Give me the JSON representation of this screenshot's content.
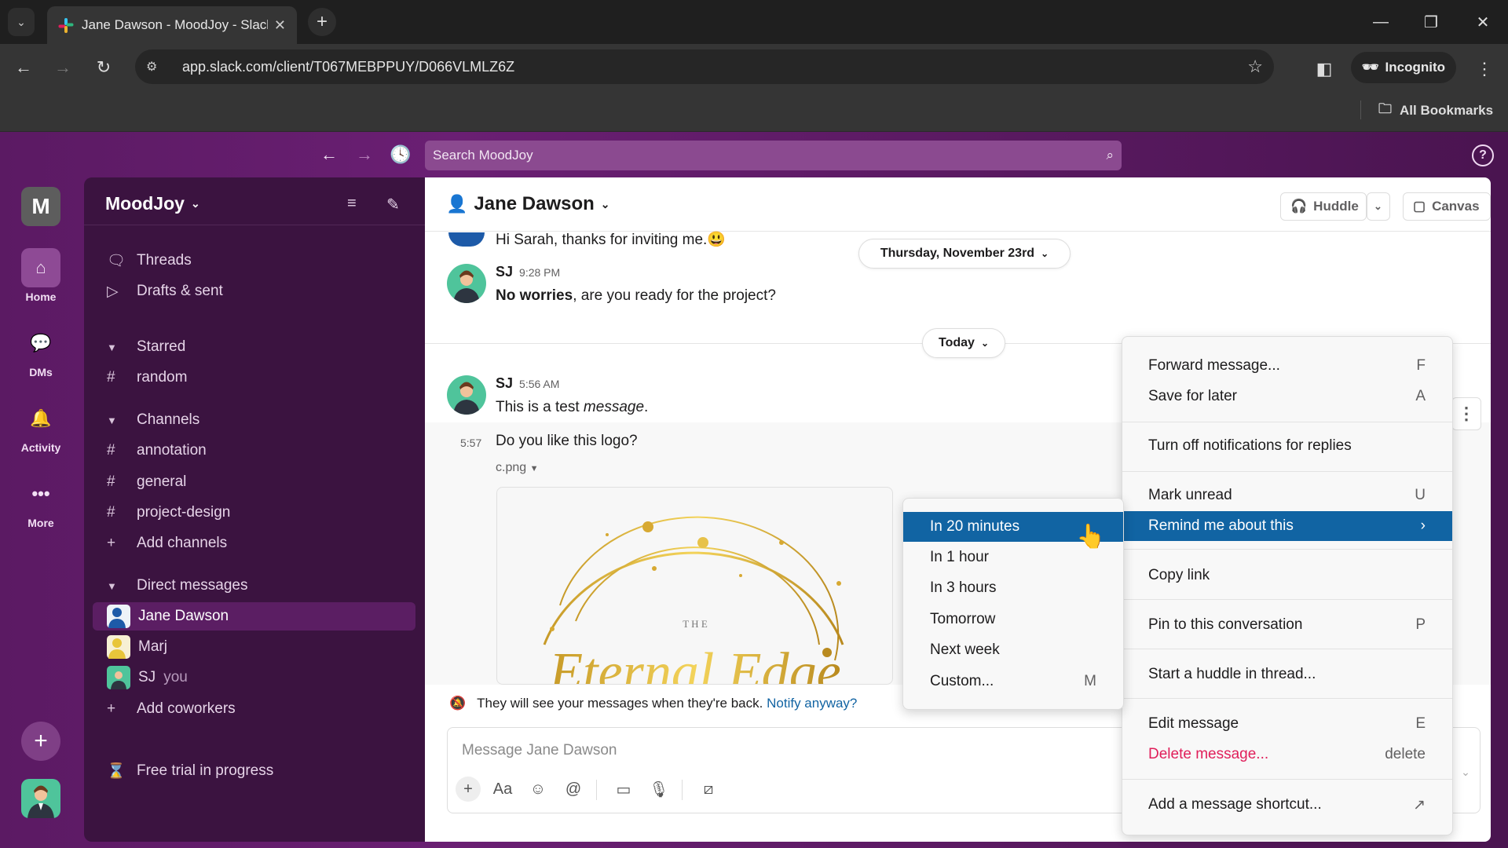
{
  "browser": {
    "tab_title": "Jane Dawson - MoodJoy - Slack",
    "url": "app.slack.com/client/T067MEBPPUY/D066VLMLZ6Z",
    "incognito_label": "Incognito",
    "bookmarks_label": "All Bookmarks"
  },
  "topbar": {
    "search_placeholder": "Search MoodJoy"
  },
  "rail": {
    "workspace_initial": "M",
    "items": [
      {
        "label": "Home",
        "icon": "home-icon",
        "active": true
      },
      {
        "label": "DMs",
        "icon": "dms-icon"
      },
      {
        "label": "Activity",
        "icon": "bell-icon"
      },
      {
        "label": "More",
        "icon": "more-icon"
      }
    ]
  },
  "sidebar": {
    "workspace_name": "MoodJoy",
    "top_items": [
      {
        "label": "Threads",
        "icon": "threads-icon"
      },
      {
        "label": "Drafts & sent",
        "icon": "send-icon"
      }
    ],
    "starred": {
      "header": "Starred",
      "items": [
        "random"
      ]
    },
    "channels": {
      "header": "Channels",
      "items": [
        "annotation",
        "general",
        "project-design"
      ],
      "add_label": "Add channels"
    },
    "dms": {
      "header": "Direct messages",
      "items": [
        {
          "name": "Jane Dawson",
          "selected": true
        },
        {
          "name": "Marj"
        },
        {
          "name": "SJ",
          "suffix": "you"
        }
      ],
      "add_label": "Add coworkers"
    },
    "trial_label": "Free trial in progress"
  },
  "channel": {
    "title": "Jane Dawson",
    "huddle_label": "Huddle",
    "canvas_label": "Canvas"
  },
  "messages": {
    "partial_text": "Hi Sarah, thanks for inviting me.",
    "partial_emoji": "😃",
    "date_divider_1": "Thursday, November 23rd",
    "msg1": {
      "author": "SJ",
      "time": "9:28 PM",
      "text_bold": "No worries",
      "text_rest": ", are you ready for the project?"
    },
    "date_divider_2": "Today",
    "msg2": {
      "author": "SJ",
      "time": "5:56 AM",
      "text": "This is a test ",
      "text_italic": "message",
      "text_end": "."
    },
    "msg3": {
      "time": "5:57",
      "text": "Do you like this logo?",
      "file_name": "c.png"
    },
    "logo_text_top": "T H E",
    "logo_script": "Eternal Edge"
  },
  "notice": {
    "text": "They will see your messages when they're back.",
    "link": "Notify anyway?"
  },
  "composer": {
    "placeholder": "Message Jane Dawson"
  },
  "context_menu": {
    "items": [
      {
        "label": "Forward message...",
        "key": "F"
      },
      {
        "label": "Save for later",
        "key": "A"
      },
      {
        "label": "Turn off notifications for replies",
        "key": ""
      },
      {
        "label": "Mark unread",
        "key": "U"
      },
      {
        "label": "Remind me about this",
        "key": "›",
        "highlighted": true
      },
      {
        "label": "Copy link",
        "key": ""
      },
      {
        "label": "Pin to this conversation",
        "key": "P"
      },
      {
        "label": "Start a huddle in thread...",
        "key": ""
      },
      {
        "label": "Edit message",
        "key": "E"
      },
      {
        "label": "Delete message...",
        "key": "delete",
        "danger": true
      },
      {
        "label": "Add a message shortcut...",
        "key": "↗"
      }
    ]
  },
  "remind_submenu": {
    "items": [
      {
        "label": "In 20 minutes",
        "highlighted": true
      },
      {
        "label": "In 1 hour"
      },
      {
        "label": "In 3 hours"
      },
      {
        "label": "Tomorrow"
      },
      {
        "label": "Next week"
      },
      {
        "label": "Custom...",
        "key": "M"
      }
    ]
  },
  "colors": {
    "aubergine": "#3f0e40",
    "highlight": "#1164a3",
    "danger": "#e01e5a",
    "link": "#1264a3"
  }
}
